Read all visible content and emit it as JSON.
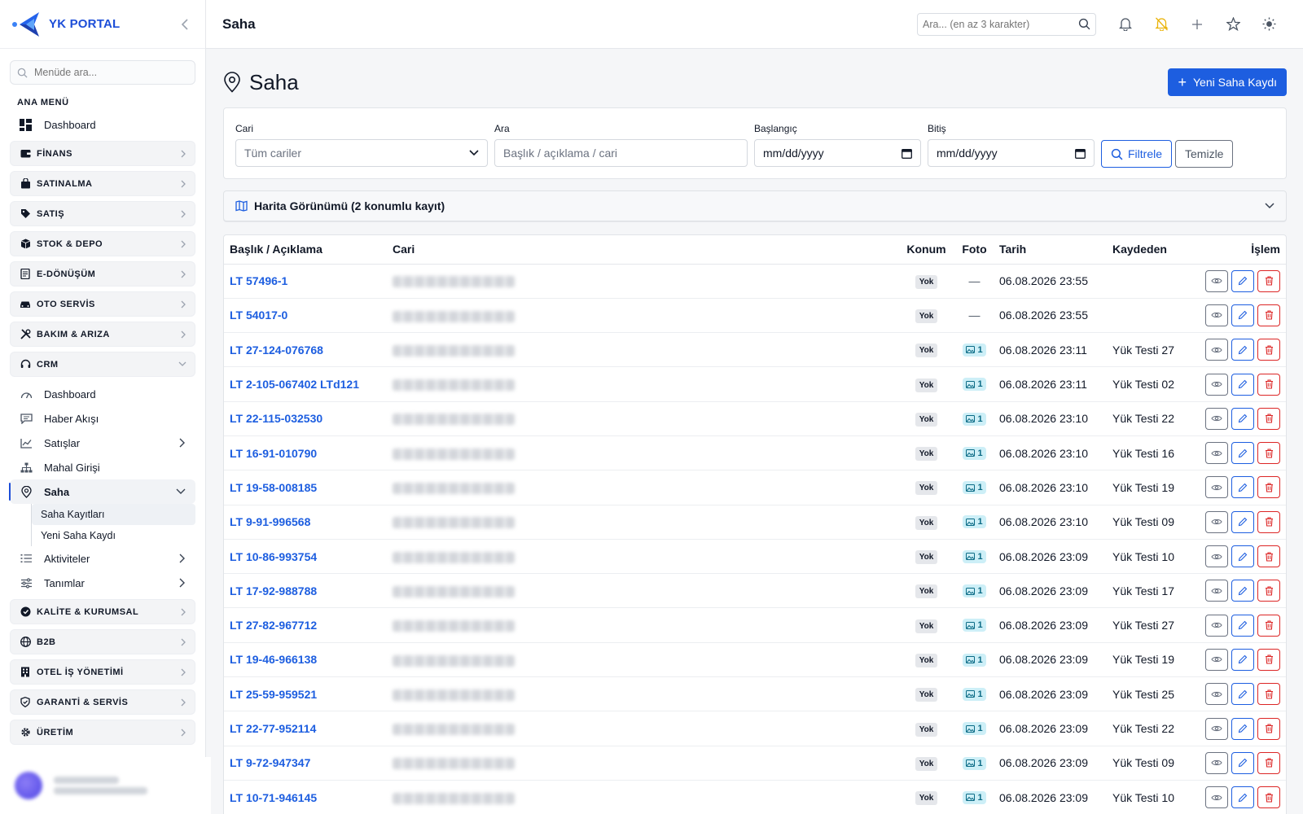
{
  "brand": {
    "name": "YK PORTAL"
  },
  "sidebar": {
    "search_placeholder": "Menüde ara...",
    "section_label": "ANA MENÜ",
    "dashboard_label": "Dashboard",
    "groups_top": [
      {
        "label": "FİNANS",
        "icon": "wallet-icon"
      },
      {
        "label": "SATINALMA",
        "icon": "bag-icon"
      },
      {
        "label": "SATIŞ",
        "icon": "tag-icon"
      },
      {
        "label": "STOK & DEPO",
        "icon": "box-icon"
      },
      {
        "label": "E-DÖNÜŞÜM",
        "icon": "doc-icon"
      },
      {
        "label": "OTO SERVİS",
        "icon": "car-icon"
      },
      {
        "label": "BAKIM & ARIZA",
        "icon": "tools-icon"
      },
      {
        "label": "CRM",
        "icon": "headset-icon"
      }
    ],
    "crm_items": [
      {
        "label": "Dashboard",
        "icon": "gauge-icon"
      },
      {
        "label": "Haber Akışı",
        "icon": "chat-icon"
      },
      {
        "label": "Satışlar",
        "icon": "chart-line-icon"
      },
      {
        "label": "Mahal Girişi",
        "icon": "sitemap-icon"
      },
      {
        "label": "Saha",
        "icon": "location-pin-icon"
      }
    ],
    "saha_sub": [
      {
        "label": "Saha Kayıtları"
      },
      {
        "label": "Yeni Saha Kaydı"
      }
    ],
    "crm_items_after": [
      {
        "label": "Aktiviteler",
        "icon": "list-icon"
      },
      {
        "label": "Tanımlar",
        "icon": "sliders-icon"
      }
    ],
    "groups_bottom": [
      {
        "label": "KALİTE & KURUMSAL",
        "icon": "award-icon"
      },
      {
        "label": "B2B",
        "icon": "globe-icon"
      },
      {
        "label": "OTEL İŞ YÖNETİMİ",
        "icon": "building-icon"
      },
      {
        "label": "GARANTİ & SERVİS",
        "icon": "shield-icon"
      },
      {
        "label": "ÜRETİM",
        "icon": "gear-icon"
      }
    ]
  },
  "topbar": {
    "title": "Saha",
    "search_placeholder": "Ara... (en az 3 karakter)"
  },
  "page": {
    "title": "Saha",
    "new_button": "Yeni Saha Kaydı"
  },
  "filters": {
    "cari_label": "Cari",
    "cari_value": "Tüm cariler",
    "ara_label": "Ara",
    "ara_placeholder": "Başlık / açıklama / cari",
    "start_label": "Başlangıç",
    "start_value": "mm/dd/yyyy",
    "end_label": "Bitiş",
    "end_value": "mm/dd/yyyy",
    "filter_button": "Filtrele",
    "clear_button": "Temizle"
  },
  "map": {
    "label": "Harita Görünümü (2 konumlu kayıt)"
  },
  "table": {
    "columns": [
      "Başlık / Açıklama",
      "Cari",
      "Konum",
      "Foto",
      "Tarih",
      "Kaydeden",
      "İşlem"
    ],
    "rows": [
      {
        "title": "LT 57496-1",
        "konum": "Yok",
        "foto": "—",
        "tarih": "06.08.2026 23:55",
        "kaydeden": ""
      },
      {
        "title": "LT 54017-0",
        "konum": "Yok",
        "foto": "—",
        "tarih": "06.08.2026 23:55",
        "kaydeden": ""
      },
      {
        "title": "LT 27-124-076768",
        "konum": "Yok",
        "foto": "1",
        "tarih": "06.08.2026 23:11",
        "kaydeden": "Yük Testi 27"
      },
      {
        "title": "LT 2-105-067402 LTd121",
        "konum": "Yok",
        "foto": "1",
        "tarih": "06.08.2026 23:11",
        "kaydeden": "Yük Testi 02"
      },
      {
        "title": "LT 22-115-032530",
        "konum": "Yok",
        "foto": "1",
        "tarih": "06.08.2026 23:10",
        "kaydeden": "Yük Testi 22"
      },
      {
        "title": "LT 16-91-010790",
        "konum": "Yok",
        "foto": "1",
        "tarih": "06.08.2026 23:10",
        "kaydeden": "Yük Testi 16"
      },
      {
        "title": "LT 19-58-008185",
        "konum": "Yok",
        "foto": "1",
        "tarih": "06.08.2026 23:10",
        "kaydeden": "Yük Testi 19"
      },
      {
        "title": "LT 9-91-996568",
        "konum": "Yok",
        "foto": "1",
        "tarih": "06.08.2026 23:10",
        "kaydeden": "Yük Testi 09"
      },
      {
        "title": "LT 10-86-993754",
        "konum": "Yok",
        "foto": "1",
        "tarih": "06.08.2026 23:09",
        "kaydeden": "Yük Testi 10"
      },
      {
        "title": "LT 17-92-988788",
        "konum": "Yok",
        "foto": "1",
        "tarih": "06.08.2026 23:09",
        "kaydeden": "Yük Testi 17"
      },
      {
        "title": "LT 27-82-967712",
        "konum": "Yok",
        "foto": "1",
        "tarih": "06.08.2026 23:09",
        "kaydeden": "Yük Testi 27"
      },
      {
        "title": "LT 19-46-966138",
        "konum": "Yok",
        "foto": "1",
        "tarih": "06.08.2026 23:09",
        "kaydeden": "Yük Testi 19"
      },
      {
        "title": "LT 25-59-959521",
        "konum": "Yok",
        "foto": "1",
        "tarih": "06.08.2026 23:09",
        "kaydeden": "Yük Testi 25"
      },
      {
        "title": "LT 22-77-952114",
        "konum": "Yok",
        "foto": "1",
        "tarih": "06.08.2026 23:09",
        "kaydeden": "Yük Testi 22"
      },
      {
        "title": "LT 9-72-947347",
        "konum": "Yok",
        "foto": "1",
        "tarih": "06.08.2026 23:09",
        "kaydeden": "Yük Testi 09"
      },
      {
        "title": "LT 10-71-946145",
        "konum": "Yok",
        "foto": "1",
        "tarih": "06.08.2026 23:09",
        "kaydeden": "Yük Testi 10"
      }
    ]
  },
  "colors": {
    "primary": "#1d5ee0",
    "danger": "#dc2626",
    "info_bg": "#cdeff7"
  }
}
